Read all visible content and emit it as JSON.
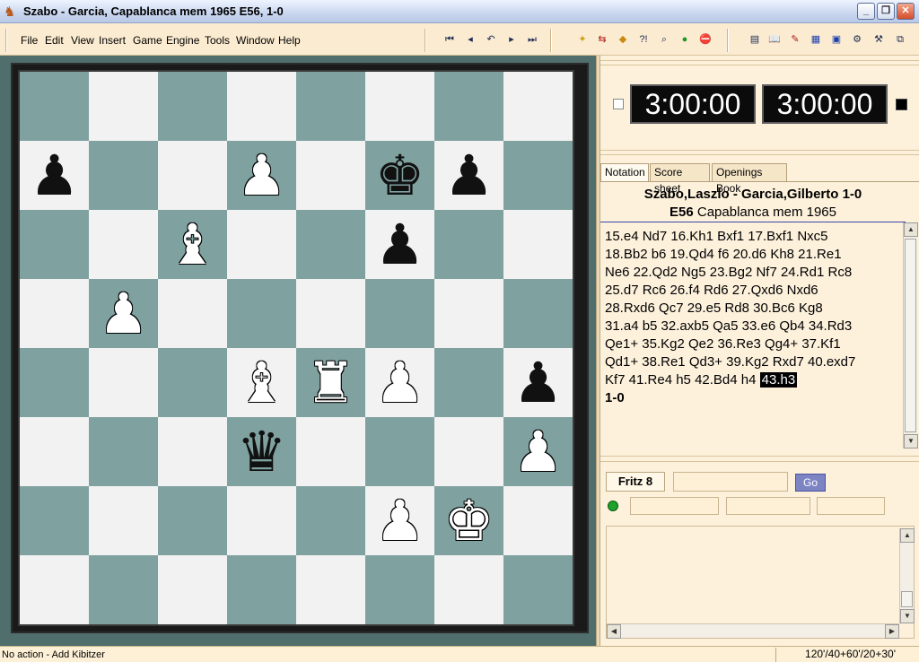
{
  "window": {
    "title": "Szabo - Garcia, Capablanca mem 1965  E56, 1-0"
  },
  "menu": [
    "File",
    "Edit",
    "View",
    "Insert",
    "Game",
    "Engine",
    "Tools",
    "Window",
    "Help"
  ],
  "toolbar": {
    "nav_icons": [
      "first-move-icon",
      "previous-move-icon",
      "take-back-icon",
      "next-move-icon",
      "last-move-icon"
    ],
    "tool_icons": [
      "new-game-icon",
      "flip-board-icon",
      "hint-icon",
      "analysis-icon",
      "zoom-icon",
      "accept-icon",
      "stop-icon"
    ],
    "right_icons": [
      "database-icon",
      "book-icon",
      "notation-icon",
      "clipboard-icon",
      "board-window-icon",
      "engine-window-icon",
      "tools-icon",
      "layout-icon"
    ]
  },
  "board": {
    "pieces": [
      {
        "square": "a7",
        "piece": "p"
      },
      {
        "square": "d7",
        "piece": "P"
      },
      {
        "square": "f7",
        "piece": "k"
      },
      {
        "square": "g7",
        "piece": "p"
      },
      {
        "square": "c6",
        "piece": "B"
      },
      {
        "square": "f6",
        "piece": "p"
      },
      {
        "square": "b5",
        "piece": "P"
      },
      {
        "square": "d4",
        "piece": "B"
      },
      {
        "square": "e4",
        "piece": "R"
      },
      {
        "square": "f4",
        "piece": "P"
      },
      {
        "square": "h4",
        "piece": "p"
      },
      {
        "square": "d3",
        "piece": "q"
      },
      {
        "square": "h3",
        "piece": "P"
      },
      {
        "square": "f2",
        "piece": "P"
      },
      {
        "square": "g2",
        "piece": "K"
      }
    ]
  },
  "clocks": {
    "white": "3:00:00",
    "black": "3:00:00"
  },
  "tabs": [
    "Notation",
    "Score sheet",
    "Openings Book"
  ],
  "game": {
    "players": "Szabo,Laszlo - Garcia,Gilberto  1-0",
    "eco": "E56",
    "event": "Capablanca mem 1965",
    "move_lines": [
      "15.e4  Nd7  16.Kh1  Bxf1  17.Bxf1  Nxc5",
      "18.Bb2  b6  19.Qd4  f6  20.d6  Kh8  21.Re1",
      "Ne6  22.Qd2  Ng5  23.Bg2  Nf7  24.Rd1  Rc8",
      "25.d7  Rc6  26.f4  Rd6  27.Qxd6  Nxd6",
      "28.Rxd6  Qc7  29.e5  Rd8  30.Bc6  Kg8",
      "31.a4  b5  32.axb5  Qa5  33.e6  Qb4  34.Rd3",
      "Qe1+  35.Kg2  Qe2  36.Re3  Qg4+  37.Kf1",
      "Qd1+  38.Re1  Qd3+  39.Kg2  Rxd7  40.exd7"
    ],
    "last_line_prefix": "Kf7  41.Re4  h5  42.Bd4  h4 ",
    "current_move": "43.h3",
    "result": "1-0"
  },
  "engine": {
    "name": "Fritz 8",
    "go_label": "Go"
  },
  "status": {
    "left": "No action - Add Kibitzer",
    "right": "120'/40+60'/20+30'"
  }
}
